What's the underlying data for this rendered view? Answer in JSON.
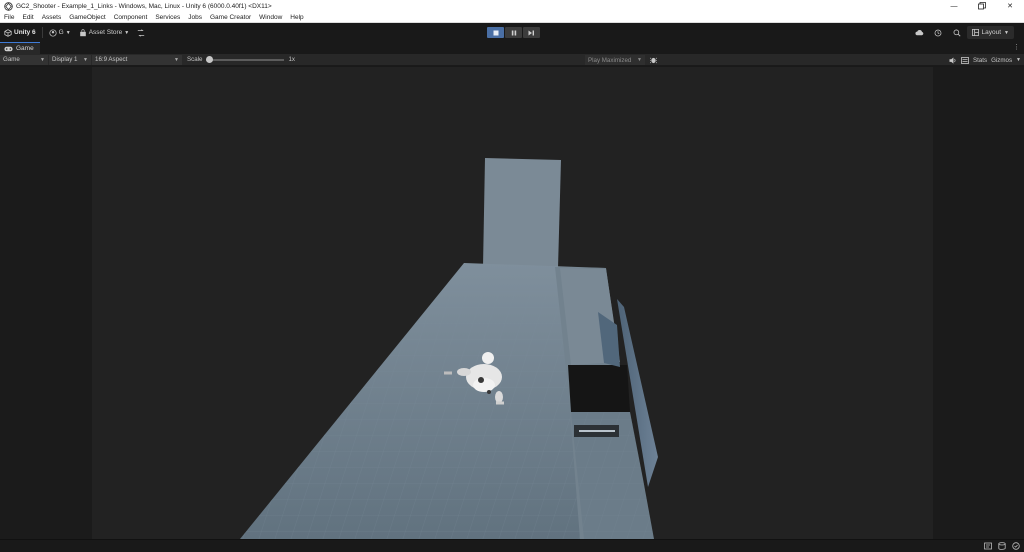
{
  "window": {
    "title": "GC2_Shooter - Example_1_Links - Windows, Mac, Linux - Unity 6 (6000.0.40f1) <DX11>",
    "controls": [
      "minimize-icon",
      "restore-icon",
      "close-icon"
    ]
  },
  "menu": {
    "items": [
      "File",
      "Edit",
      "Assets",
      "GameObject",
      "Component",
      "Services",
      "Jobs",
      "Game Creator",
      "Window",
      "Help"
    ]
  },
  "toolbar": {
    "brand": "Unity 6",
    "account": "G",
    "asset_store": "Asset Store",
    "layout": "Layout"
  },
  "tabs": {
    "game": "Game"
  },
  "gamebar": {
    "view_mode": "Game",
    "display": "Display 1",
    "aspect": "16:9 Aspect",
    "scale_label": "Scale",
    "scale_value": "1x",
    "scale_fraction": 0.0,
    "play_mode": "Play Maximized",
    "stats": "Stats",
    "gizmos": "Gizmos"
  },
  "colors": {
    "accent": "#3f7bd6",
    "play_active": "#4a6fa5",
    "floor": "#6b7d8c",
    "wall": "#7b8a96"
  }
}
